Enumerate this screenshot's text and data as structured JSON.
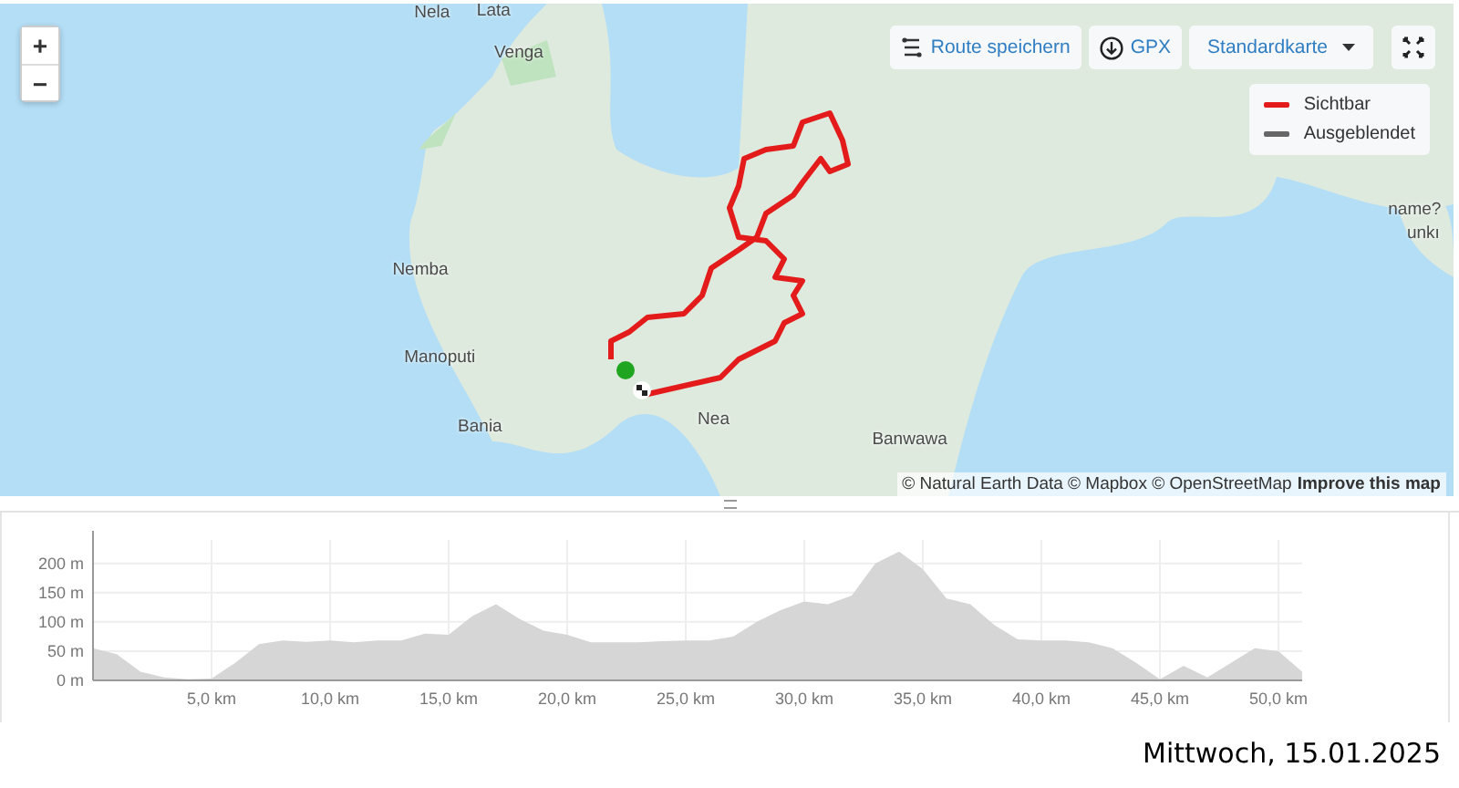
{
  "map": {
    "zoom_buttons": [
      "+",
      "−"
    ],
    "toolbar": {
      "save_route": "Route speichern",
      "gpx": "GPX",
      "map_style": "Standardkarte"
    },
    "legend": [
      {
        "label": "Sichtbar",
        "color": "#e31b1b"
      },
      {
        "label": "Ausgeblendet",
        "color": "#666666"
      }
    ],
    "places": [
      "Nela",
      "Lata",
      "Venga",
      "Nemba",
      "Manoputi",
      "Bania",
      "Nea",
      "Banwawa",
      "name?",
      "unkı"
    ],
    "attribution": "© Natural Earth Data © Mapbox © OpenStreetMap",
    "improve_link": "Improve this map"
  },
  "elevation": {
    "chart_data": {
      "type": "area",
      "x": [
        0,
        1,
        2,
        3,
        4,
        5,
        6,
        7,
        8,
        9,
        10,
        11,
        12,
        13,
        14,
        15,
        16,
        17,
        18,
        19,
        20,
        21,
        22,
        23,
        24,
        25,
        26,
        27,
        28,
        29,
        30,
        31,
        32,
        33,
        34,
        35,
        36,
        37,
        38,
        39,
        40,
        41,
        42,
        43,
        44,
        45,
        46,
        47,
        48,
        49,
        50,
        51
      ],
      "grid": true,
      "series": [
        {
          "color": "#d6d6d6",
          "values": [
            55,
            45,
            15,
            5,
            2,
            3,
            30,
            62,
            68,
            66,
            68,
            65,
            68,
            68,
            80,
            78,
            110,
            130,
            105,
            85,
            78,
            65,
            65,
            65,
            67,
            68,
            68,
            75,
            100,
            120,
            135,
            130,
            145,
            200,
            220,
            190,
            140,
            130,
            95,
            70,
            68,
            68,
            65,
            55,
            30,
            2,
            25,
            5,
            30,
            55,
            50,
            15
          ]
        }
      ],
      "xlim": [
        0,
        51
      ],
      "ylim": [
        0,
        240
      ],
      "xticks": [
        {
          "value": 5,
          "label": "5,0 km"
        },
        {
          "value": 10,
          "label": "10,0 km"
        },
        {
          "value": 15,
          "label": "15,0 km"
        },
        {
          "value": 20,
          "label": "20,0 km"
        },
        {
          "value": 25,
          "label": "25,0 km"
        },
        {
          "value": 30,
          "label": "30,0 km"
        },
        {
          "value": 35,
          "label": "35,0 km"
        },
        {
          "value": 40,
          "label": "40,0 km"
        },
        {
          "value": 45,
          "label": "45,0 km"
        },
        {
          "value": 50,
          "label": "50,0 km"
        }
      ],
      "yticks": [
        {
          "value": 0,
          "label": "0 m"
        },
        {
          "value": 50,
          "label": "50 m"
        },
        {
          "value": 100,
          "label": "100 m"
        },
        {
          "value": 150,
          "label": "150 m"
        },
        {
          "value": 200,
          "label": "200 m"
        }
      ]
    }
  },
  "date": "Mittwoch, 15.01.2025"
}
